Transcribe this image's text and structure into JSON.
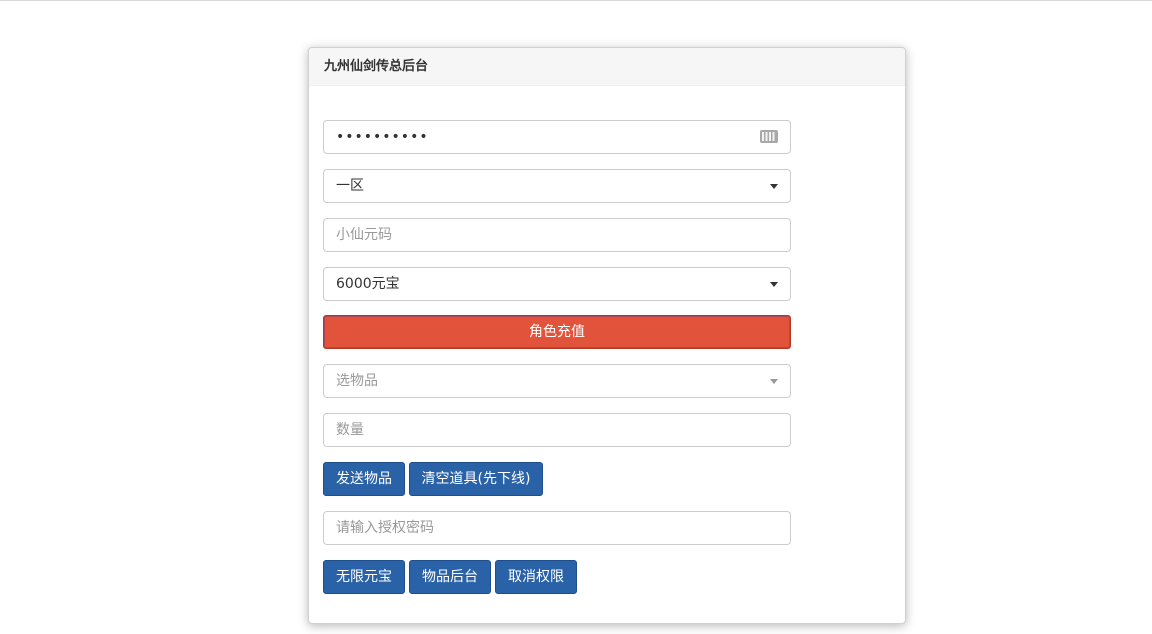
{
  "panel": {
    "title": "九州仙剑传总后台"
  },
  "form": {
    "password_value": "••••••••••",
    "server_select": "一区",
    "code_placeholder": "小仙元码",
    "amount_select": "6000元宝",
    "recharge_label": "角色充值",
    "item_select_placeholder": "选物品",
    "quantity_placeholder": "数量",
    "send_item_label": "发送物品",
    "clear_items_label": "清空道具(先下线)",
    "auth_placeholder": "请输入授权密码",
    "unlimited_label": "无限元宝",
    "item_admin_label": "物品后台",
    "revoke_label": "取消权限"
  },
  "icons": {
    "password_keyboard": "keyboard-icon",
    "dropdown": "caret-down-icon"
  },
  "colors": {
    "recharge_button": "#e2533b",
    "primary_button": "#2a62a8"
  }
}
